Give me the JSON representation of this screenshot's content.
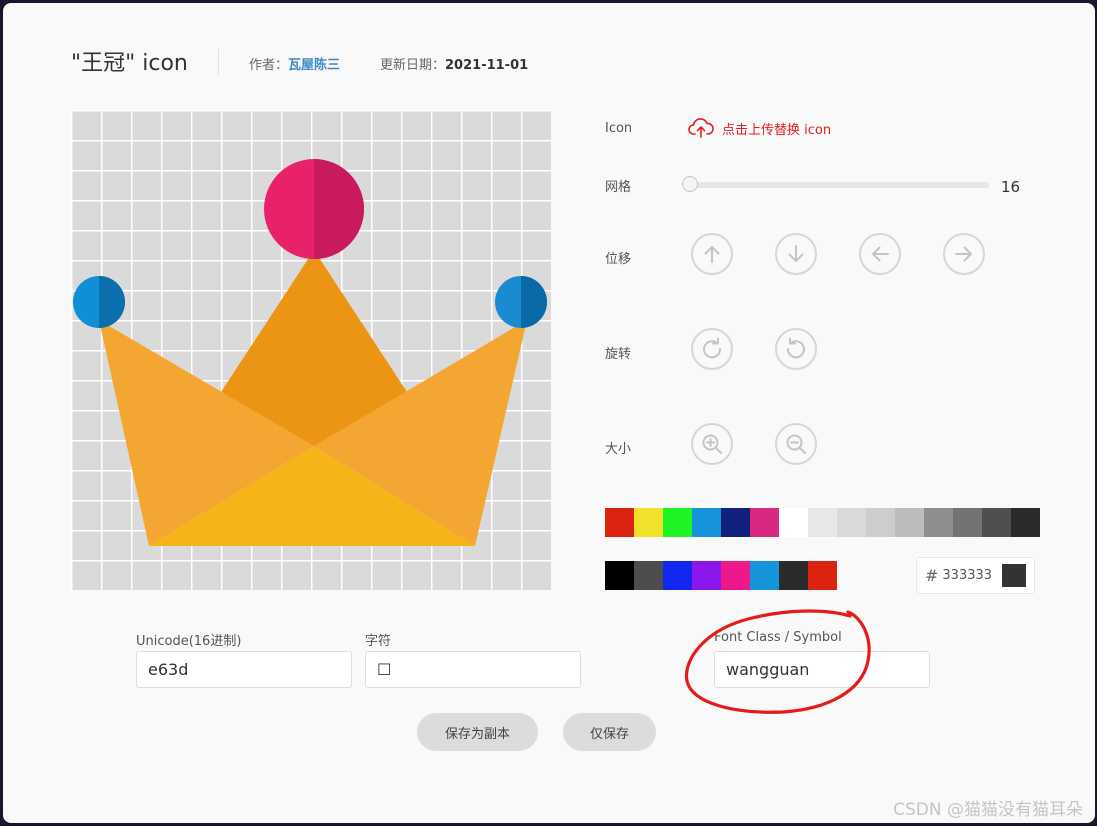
{
  "header": {
    "title": "\"王冠\" icon",
    "author_label": "作者：",
    "author_name": "瓦屋陈三",
    "date_label": "更新日期：",
    "date_value": "2021-11-01"
  },
  "panel": {
    "icon_label": "Icon",
    "upload_text": "点击上传替换 icon",
    "grid_label": "网格",
    "grid_value": "16",
    "move_label": "位移",
    "rotate_label": "旋转",
    "size_label": "大小"
  },
  "icons": {
    "move": [
      "arrow-up-icon",
      "arrow-down-icon",
      "arrow-left-icon",
      "arrow-right-icon"
    ],
    "rotate": [
      "rotate-clockwise-icon",
      "rotate-counterclockwise-icon"
    ],
    "size": [
      "zoom-in-icon",
      "zoom-out-icon"
    ]
  },
  "palette": {
    "row1": [
      "#dc2310",
      "#f2e12c",
      "#1ef424",
      "#1593db",
      "#13217e",
      "#d6297f",
      "#ffffff",
      "#e7e7e7",
      "#d9d9d9",
      "#cdcdcd",
      "#bcbcbc",
      "#8e8e8e",
      "#737373",
      "#4f4f4f",
      "#2b2b2b"
    ],
    "row2": [
      "#000000",
      "#4d4d4d",
      "#1227ef",
      "#8b17ec",
      "#f0178b",
      "#1593db",
      "#2b2b2b",
      "#dc2310"
    ],
    "hex_value": "333333",
    "preview_color": "#333333"
  },
  "fields": {
    "unicode_label": "Unicode(16进制)",
    "unicode_value": "e63d",
    "char_label": "字符",
    "char_value": "☐",
    "fontclass_label": "Font Class / Symbol",
    "fontclass_value": "wangguan"
  },
  "buttons": {
    "save_copy": "保存为副本",
    "save_only": "仅保存"
  },
  "watermark": "CSDN @猫猫没有猫耳朵"
}
